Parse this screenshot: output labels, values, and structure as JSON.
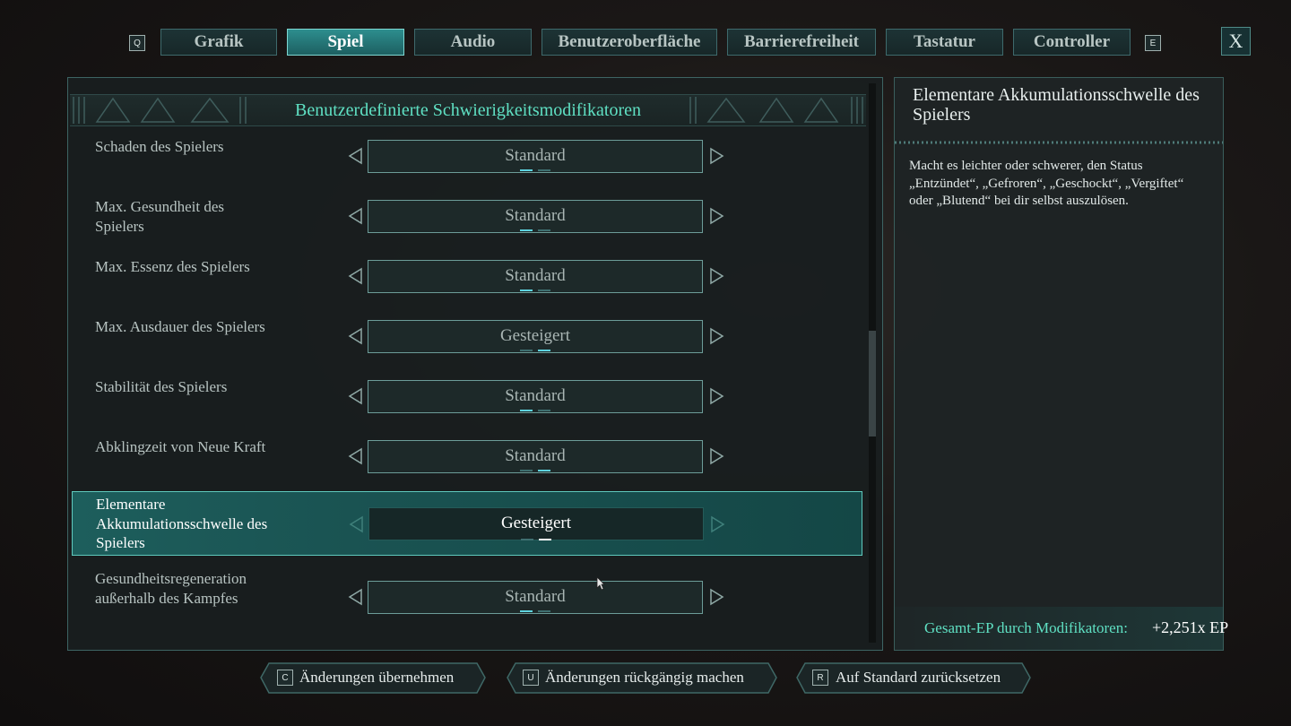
{
  "tabs": {
    "left_key": "Q",
    "right_key": "E",
    "items": [
      {
        "label": "Grafik"
      },
      {
        "label": "Spiel"
      },
      {
        "label": "Audio"
      },
      {
        "label": "Benutzeroberfläche"
      },
      {
        "label": "Barrierefreiheit"
      },
      {
        "label": "Tastatur"
      },
      {
        "label": "Controller"
      }
    ],
    "active": "Spiel",
    "close_label": "X"
  },
  "section": {
    "title": "Benutzerdefinierte Schwierigkeitsmodifikatoren"
  },
  "settings": [
    {
      "label": "Schaden des Spielers",
      "value": "Standard",
      "level_index": 1,
      "level_count": 2
    },
    {
      "label": "Max. Gesundheit des Spielers",
      "value": "Standard",
      "level_index": 1,
      "level_count": 2
    },
    {
      "label": "Max. Essenz des Spielers",
      "value": "Standard",
      "level_index": 1,
      "level_count": 2
    },
    {
      "label": "Max. Ausdauer des Spielers",
      "value": "Gesteigert",
      "level_index": 2,
      "level_count": 2
    },
    {
      "label": "Stabilität des Spielers",
      "value": "Standard",
      "level_index": 1,
      "level_count": 2
    },
    {
      "label": "Abklingzeit von Neue Kraft",
      "value": "Standard",
      "level_index": 2,
      "level_count": 2
    },
    {
      "label": "Elementare Akkumulationsschwelle des Spielers",
      "value": "Gesteigert",
      "level_index": 2,
      "level_count": 2,
      "selected": true
    },
    {
      "label": "Gesundheitsregeneration außerhalb des Kampfes",
      "value": "Standard",
      "level_index": 1,
      "level_count": 2
    }
  ],
  "detail": {
    "title": "Elementare Akkumulationsschwelle des Spielers",
    "description": "Macht es leichter oder schwerer, den Status „Entzündet“, „Gefroren“, „Geschockt“, „Vergiftet“ oder „Blutend“ bei dir selbst auszulösen.",
    "ep_label": "Gesamt-EP durch Modifikatoren:",
    "ep_value": "+2,251x EP"
  },
  "bottom_actions": [
    {
      "key": "C",
      "label": "Änderungen übernehmen"
    },
    {
      "key": "U",
      "label": "Änderungen rückgängig machen"
    },
    {
      "key": "R",
      "label": "Auf Standard zurücksetzen"
    }
  ],
  "colors": {
    "accent_teal": "#5fe0c3",
    "active_tab": "#2d8e8e",
    "selected_row": "#1d5e5c",
    "indicator_on": "#5ed3df"
  }
}
